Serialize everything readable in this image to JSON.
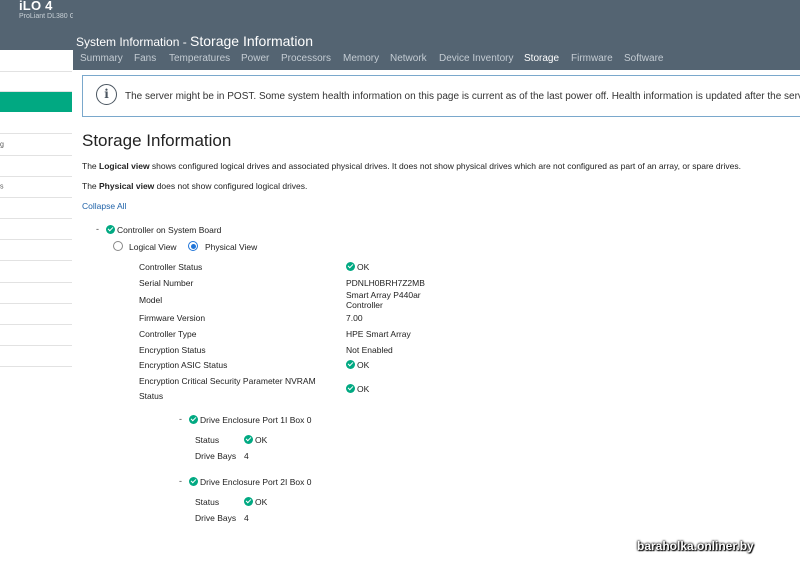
{
  "app": {
    "title": "iLO 4",
    "model": "ProLiant DL380 Gen9"
  },
  "sidebar": {
    "items": [
      {
        "label": ""
      },
      {
        "label": ""
      },
      {
        "label": ""
      },
      {
        "label": ""
      },
      {
        "label": "g"
      },
      {
        "label": ""
      },
      {
        "label": "s"
      },
      {
        "label": ""
      },
      {
        "label": ""
      },
      {
        "label": ""
      },
      {
        "label": ""
      },
      {
        "label": ""
      },
      {
        "label": ""
      },
      {
        "label": ""
      },
      {
        "label": ""
      }
    ]
  },
  "header": {
    "prefix": "System Information - ",
    "title": "Storage Information"
  },
  "tabs": [
    {
      "label": "Summary"
    },
    {
      "label": "Fans"
    },
    {
      "label": "Temperatures"
    },
    {
      "label": "Power"
    },
    {
      "label": "Processors"
    },
    {
      "label": "Memory"
    },
    {
      "label": "Network"
    },
    {
      "label": "Device Inventory"
    },
    {
      "label": "Storage"
    },
    {
      "label": "Firmware"
    },
    {
      "label": "Software"
    }
  ],
  "alert": {
    "icon": "info-icon",
    "text": "The server might be in POST. Some system health information on this page is current as of the last power off. Health information is updated after the server is p"
  },
  "page": {
    "title": "Storage Information",
    "logical_prefix": "The ",
    "logical_bold": "Logical view",
    "logical_rest": " shows configured logical drives and associated physical drives. It does not show physical drives which are not configured as part of an array, or spare drives.",
    "physical_prefix": "The ",
    "physical_bold": "Physical view",
    "physical_rest": " does not show configured logical drives.",
    "collapse_label": "Collapse All"
  },
  "controller": {
    "toggle": "-",
    "name": "Controller on System Board",
    "view_logical": "Logical View",
    "view_physical": "Physical View",
    "selected_view": "physical",
    "props": {
      "status_label": "Controller Status",
      "status_value": "OK",
      "serial_label": "Serial Number",
      "serial_value": "PDNLH0BRH7Z2MB",
      "model_label": "Model",
      "model_value_1": "Smart Array P440ar",
      "model_value_2": "Controller",
      "firmware_label": "Firmware Version",
      "firmware_value": "7.00",
      "type_label": "Controller Type",
      "type_value": "HPE Smart Array",
      "enc_label": "Encryption Status",
      "enc_value": "Not Enabled",
      "asic_label": "Encryption ASIC Status",
      "asic_value": "OK",
      "csp_label_1": "Encryption Critical Security Parameter NVRAM",
      "csp_label_2": "Status",
      "csp_value": "OK"
    },
    "enclosures": [
      {
        "toggle": "-",
        "name": "Drive Enclosure Port 1I Box 0",
        "status_label": "Status",
        "status_value": "OK",
        "bays_label": "Drive Bays",
        "bays_value": "4"
      },
      {
        "toggle": "-",
        "name": "Drive Enclosure Port 2I Box 0",
        "status_label": "Status",
        "status_value": "OK",
        "bays_label": "Drive Bays",
        "bays_value": "4"
      }
    ]
  },
  "watermark": "baraholka.onliner.by",
  "colors": {
    "header_bg": "#546472",
    "accent": "#01a982",
    "link": "#1f62a8"
  }
}
